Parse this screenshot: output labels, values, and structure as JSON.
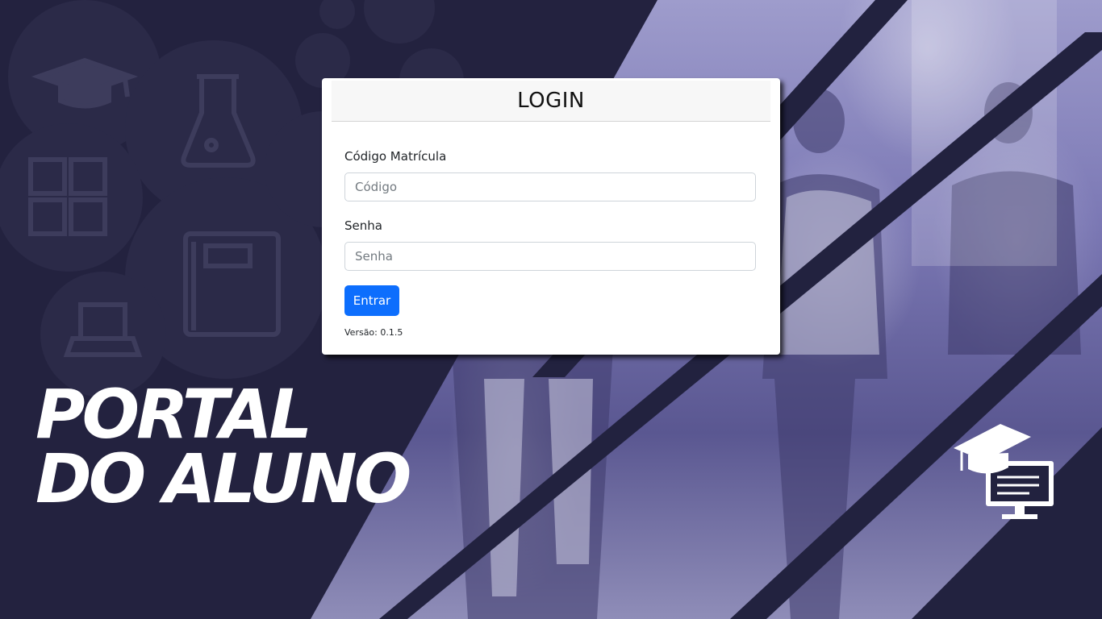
{
  "background": {
    "title_line1": "PORTAL",
    "title_line2": "DO ALUNO",
    "colors": {
      "navy": "#22223f",
      "photo_tint": "#7c79b5"
    },
    "icons": [
      "graduation-cap-icon",
      "flask-icon",
      "calculator-icon",
      "book-icon",
      "laptop-icon",
      "atom-icon",
      "graduation-computer-icon"
    ]
  },
  "login": {
    "title": "LOGIN",
    "code_label": "Código Matrícula",
    "code_placeholder": "Código",
    "password_label": "Senha",
    "password_placeholder": "Senha",
    "submit_label": "Entrar",
    "version": "Versão: 0.1.5",
    "accent_color": "#0d6efd"
  }
}
